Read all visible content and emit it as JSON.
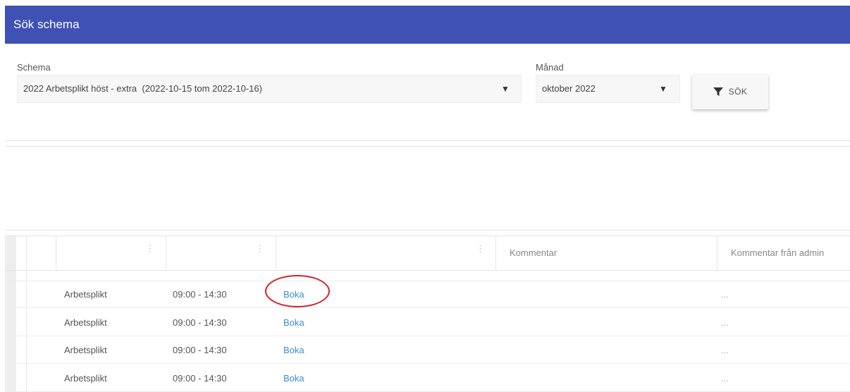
{
  "header": {
    "title": "Sök schema",
    "color": "#3f51b5"
  },
  "filters": {
    "schedule_label": "Schema",
    "schedule_value": "2022 Arbetsplikt höst - extra  (2022-10-15 tom 2022-10-16)",
    "month_label": "Månad",
    "month_value": "oktober 2022",
    "search_label": "SÖK"
  },
  "grid": {
    "columns": [
      "",
      "",
      "",
      "Kommentar",
      "Kommentar från admin"
    ],
    "rows": [
      {
        "type": "Arbetsplikt",
        "time": "09:00 - 14:30",
        "action": "Boka",
        "admin_comment": "..."
      },
      {
        "type": "Arbetsplikt",
        "time": "09:00 - 14:30",
        "action": "Boka",
        "admin_comment": "..."
      },
      {
        "type": "Arbetsplikt",
        "time": "09:00 - 14:30",
        "action": "Boka",
        "admin_comment": "..."
      },
      {
        "type": "Arbetsplikt",
        "time": "09:00 - 14:30",
        "action": "Boka",
        "admin_comment": "..."
      }
    ]
  },
  "annotation_color": "#d61f26",
  "link_color": "#3d8bd0"
}
